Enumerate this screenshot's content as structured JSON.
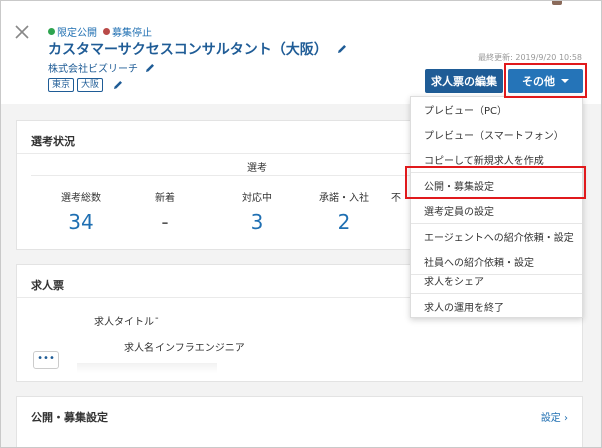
{
  "header": {
    "status_public": "限定公開",
    "status_stopped": "募集停止",
    "job_title": "カスタマーサクセスコンサルタント（大阪）",
    "company": "株式会社ビズリーチ",
    "tags": [
      "東京",
      "大阪"
    ],
    "last_updated": "最終更新: 2019/9/20 10:58",
    "edit_button": "求人票の編集",
    "other_button": "その他"
  },
  "colors": {
    "accent": "#1f5c96",
    "highlight": "#e0191c",
    "status_green": "#2ea44f",
    "status_red": "#b94a48"
  },
  "selection": {
    "title": "選考状況",
    "group_label": "選考",
    "stats": [
      {
        "label": "選考総数",
        "value": "34"
      },
      {
        "label": "新着",
        "value": "-"
      },
      {
        "label": "対応中",
        "value": "3"
      },
      {
        "label": "承諾・入社",
        "value": "2"
      },
      {
        "label": "不",
        "value": ""
      }
    ]
  },
  "job_sheet": {
    "title": "求人票",
    "fields": [
      {
        "key": "求人タイトル",
        "value": "-"
      },
      {
        "key": "求人名",
        "value": "インフラエンジニア"
      }
    ],
    "more_label": "•••"
  },
  "publish_settings": {
    "title": "公開・募集設定",
    "settings_link": "設定 ›"
  },
  "menu": {
    "items": [
      "プレビュー（PC）",
      "プレビュー（スマートフォン）",
      "コピーして新規求人を作成",
      "公開・募集設定",
      "選考定員の設定",
      "エージェントへの紹介依頼・設定",
      "社員への紹介依頼・設定",
      "求人をシェア",
      "求人の運用を終了"
    ]
  }
}
